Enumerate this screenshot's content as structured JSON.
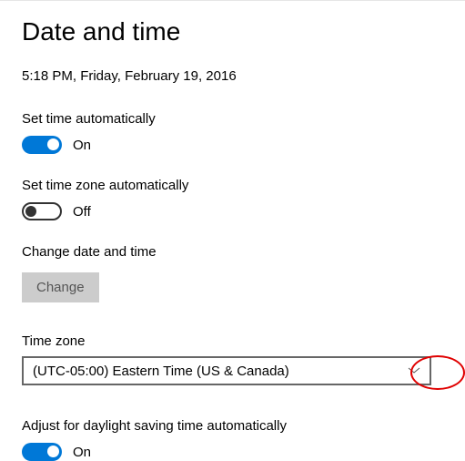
{
  "title": "Date and time",
  "current_time": "5:18 PM, Friday, February 19, 2016",
  "set_time_auto": {
    "label": "Set time automatically",
    "state": "On",
    "on": true
  },
  "set_tz_auto": {
    "label": "Set time zone automatically",
    "state": "Off",
    "on": false
  },
  "change_section": {
    "label": "Change date and time",
    "button": "Change"
  },
  "timezone": {
    "label": "Time zone",
    "selected": "(UTC-05:00) Eastern Time (US & Canada)"
  },
  "dst": {
    "label": "Adjust for daylight saving time automatically",
    "state": "On",
    "on": true
  }
}
